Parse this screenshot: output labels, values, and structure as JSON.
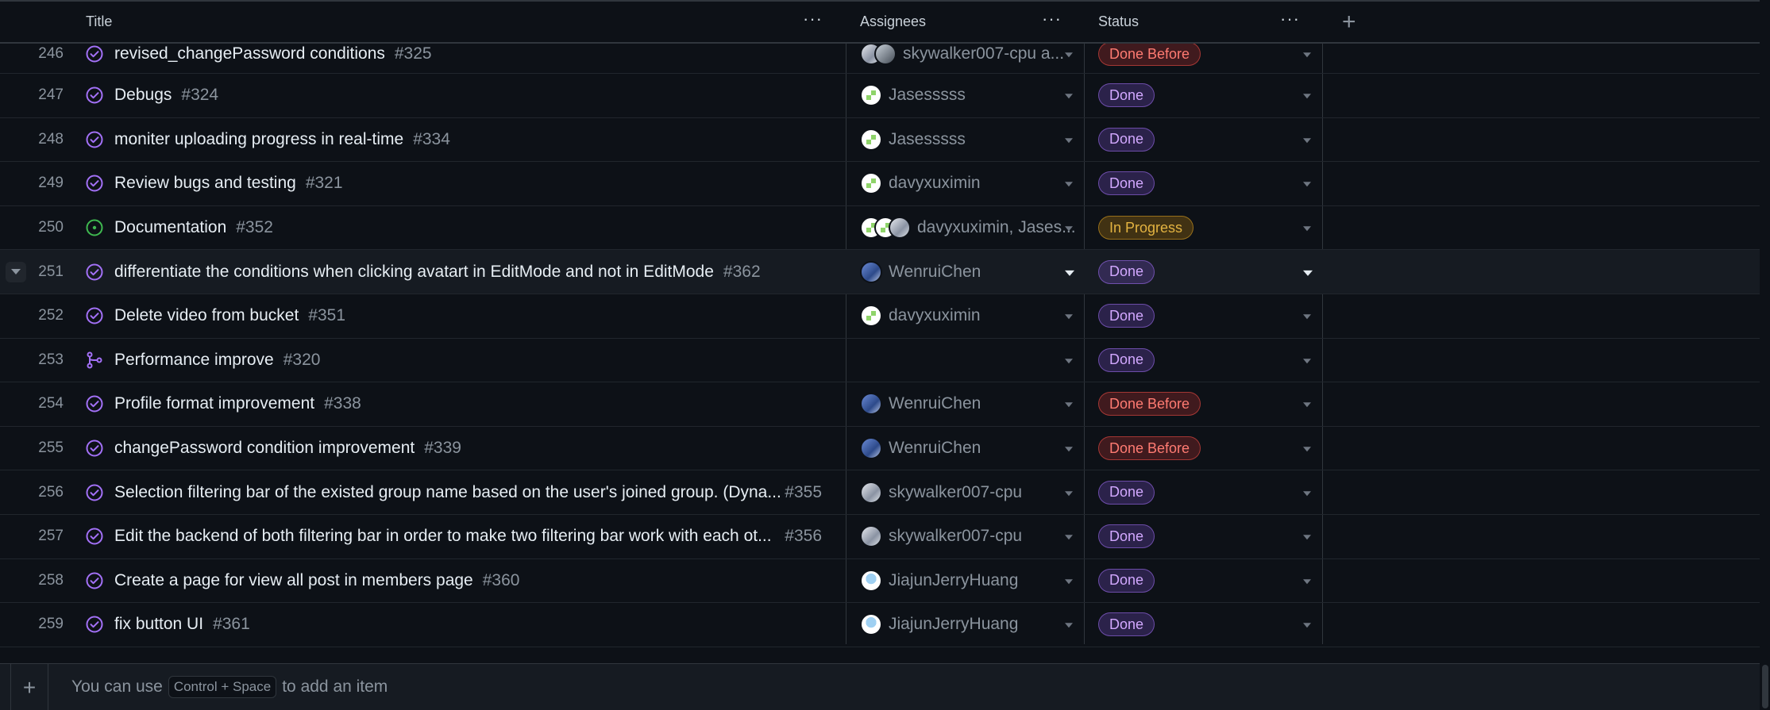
{
  "columns": {
    "title": "Title",
    "assignees": "Assignees",
    "status": "Status",
    "add_icon": "plus-icon",
    "more_icon": "kebab-icon"
  },
  "rows": [
    {
      "num": "246",
      "title": "revised_changePassword conditions",
      "issue": "#325",
      "icon": "closed",
      "assignees": "skywalker007-cpu a...",
      "avatars": [
        "grey",
        "dark"
      ],
      "status": "Done Before",
      "status_kind": "before"
    },
    {
      "num": "247",
      "title": "Debugs",
      "issue": "#324",
      "icon": "closed",
      "assignees": "Jasesssss",
      "avatars": [
        "green"
      ],
      "status": "Done",
      "status_kind": "done"
    },
    {
      "num": "248",
      "title": "moniter uploading progress in real-time",
      "issue": "#334",
      "icon": "closed",
      "assignees": "Jasesssss",
      "avatars": [
        "green"
      ],
      "status": "Done",
      "status_kind": "done"
    },
    {
      "num": "249",
      "title": "Review bugs and testing",
      "issue": "#321",
      "icon": "closed",
      "assignees": "davyxuximin",
      "avatars": [
        "green"
      ],
      "status": "Done",
      "status_kind": "done"
    },
    {
      "num": "250",
      "title": "Documentation",
      "issue": "#352",
      "icon": "open",
      "assignees": "davyxuximin, Jases...",
      "avatars": [
        "green",
        "green",
        "grey"
      ],
      "status": "In Progress",
      "status_kind": "prog"
    },
    {
      "num": "251",
      "title": "differentiate the conditions when clicking avatart in EditMode and not in EditMode",
      "issue": "#362",
      "icon": "closed",
      "assignees": "WenruiChen",
      "avatars": [
        "blue"
      ],
      "status": "Done",
      "status_kind": "done",
      "highlight": true
    },
    {
      "num": "252",
      "title": "Delete video from bucket",
      "issue": "#351",
      "icon": "closed",
      "assignees": "davyxuximin",
      "avatars": [
        "green"
      ],
      "status": "Done",
      "status_kind": "done"
    },
    {
      "num": "253",
      "title": "Performance improve",
      "issue": "#320",
      "icon": "pr",
      "assignees": "",
      "avatars": [],
      "status": "Done",
      "status_kind": "done"
    },
    {
      "num": "254",
      "title": "Profile format improvement",
      "issue": "#338",
      "icon": "closed",
      "assignees": "WenruiChen",
      "avatars": [
        "blue"
      ],
      "status": "Done Before",
      "status_kind": "before"
    },
    {
      "num": "255",
      "title": "changePassword condition improvement",
      "issue": "#339",
      "icon": "closed",
      "assignees": "WenruiChen",
      "avatars": [
        "blue"
      ],
      "status": "Done Before",
      "status_kind": "before"
    },
    {
      "num": "256",
      "title": "Selection filtering bar of the existed group name based on the user's joined group. (Dyna...",
      "issue": "#355",
      "issue_right": true,
      "icon": "closed",
      "assignees": "skywalker007-cpu",
      "avatars": [
        "grey"
      ],
      "status": "Done",
      "status_kind": "done"
    },
    {
      "num": "257",
      "title": "Edit the backend of both filtering bar in order to make two filtering bar work with each ot...",
      "issue": "#356",
      "issue_right": true,
      "icon": "closed",
      "assignees": "skywalker007-cpu",
      "avatars": [
        "grey"
      ],
      "status": "Done",
      "status_kind": "done"
    },
    {
      "num": "258",
      "title": "Create a page for view all post in members page",
      "issue": "#360",
      "icon": "closed",
      "assignees": "JiajunJerryHuang",
      "avatars": [
        "cyan"
      ],
      "status": "Done",
      "status_kind": "done"
    },
    {
      "num": "259",
      "title": "fix button UI",
      "issue": "#361",
      "icon": "closed",
      "assignees": "JiajunJerryHuang",
      "avatars": [
        "cyan"
      ],
      "status": "Done",
      "status_kind": "done"
    }
  ],
  "footer": {
    "prefix": "You can use",
    "shortcut": "Control + Space",
    "suffix": "to add an item"
  },
  "colors": {
    "background": "#0d1117",
    "done": "#d2a8ff",
    "done_before": "#ff7b72",
    "in_progress": "#e3b341",
    "closed_icon": "#a371f7",
    "open_icon": "#3fb950"
  }
}
